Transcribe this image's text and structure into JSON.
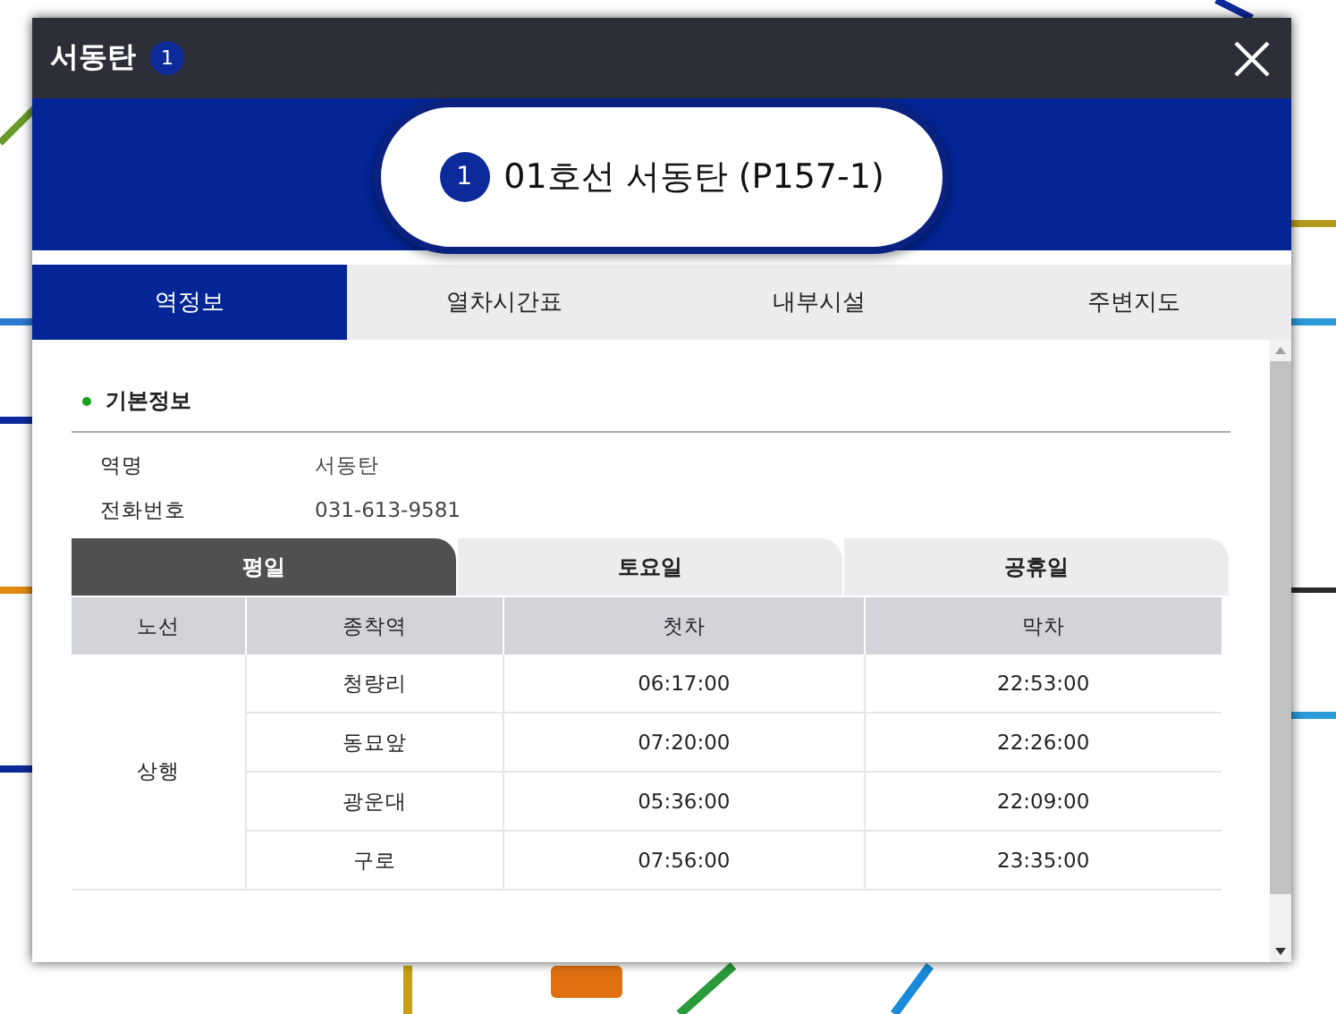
{
  "window": {
    "title": "서동탄",
    "line_badge": "1"
  },
  "station_banner": {
    "line_badge": "1",
    "text": "01호선 서동탄 (P157-1)"
  },
  "tabs": [
    {
      "label": "역정보",
      "selected": true
    },
    {
      "label": "열차시간표",
      "selected": false
    },
    {
      "label": "내부시설",
      "selected": false
    },
    {
      "label": "주변지도",
      "selected": false
    }
  ],
  "section": {
    "title": "기본정보"
  },
  "info": [
    {
      "label": "역명",
      "value": "서동탄"
    },
    {
      "label": "전화번호",
      "value": "031-613-9581"
    }
  ],
  "day_tabs": [
    {
      "label": "평일",
      "selected": true
    },
    {
      "label": "토요일",
      "selected": false
    },
    {
      "label": "공휴일",
      "selected": false
    }
  ],
  "table": {
    "columns": [
      "노선",
      "종착역",
      "첫차",
      "막차"
    ],
    "groups": [
      {
        "direction": "상행",
        "rows": [
          [
            "청량리",
            "06:17:00",
            "22:53:00"
          ],
          [
            "동묘앞",
            "07:20:00",
            "22:26:00"
          ],
          [
            "광운대",
            "05:36:00",
            "22:09:00"
          ],
          [
            "구로",
            "07:56:00",
            "23:35:00"
          ]
        ]
      }
    ]
  }
}
